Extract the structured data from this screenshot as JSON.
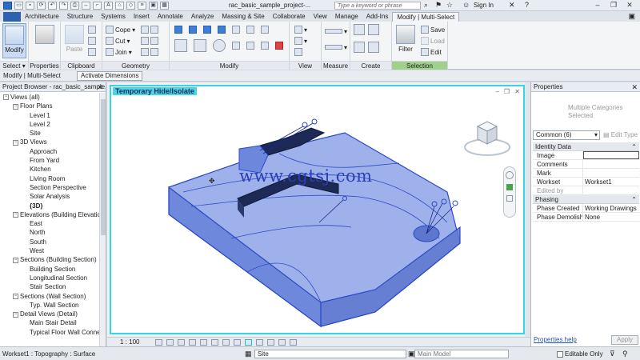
{
  "titlebar": {
    "doc_title": "rac_basic_sample_project-...",
    "search_placeholder": "Type a keyword or phrase",
    "signin": "Sign In",
    "help": "?",
    "minimize": "–",
    "restore": "❐",
    "close": "✕"
  },
  "tabs": [
    "Architecture",
    "Structure",
    "Systems",
    "Insert",
    "Annotate",
    "Analyze",
    "Massing & Site",
    "Collaborate",
    "View",
    "Manage",
    "Add-Ins",
    "Modify | Multi-Select"
  ],
  "ribbon": {
    "select": {
      "modify": "Modify",
      "label": "Select ▾"
    },
    "properties": {
      "label": "Properties"
    },
    "clipboard": {
      "paste": "Paste",
      "label": "Clipboard"
    },
    "geometry": {
      "cope": "Cope",
      "cut": "Cut",
      "join": "Join",
      "label": "Geometry"
    },
    "modify": {
      "label": "Modify"
    },
    "view": {
      "label": "View"
    },
    "measure": {
      "label": "Measure"
    },
    "create": {
      "label": "Create"
    },
    "selection": {
      "filter": "Filter",
      "save": "Save",
      "load": "Load",
      "edit": "Edit",
      "label": "Selection"
    },
    "panel_colors": {
      "selection_label_bg": "#9fd18a"
    }
  },
  "options_bar": {
    "context": "Modify | Multi-Select",
    "activate_dimensions": "Activate Dimensions"
  },
  "project_browser": {
    "title": "Project Browser - rac_basic_sample...",
    "close": "✕",
    "tree": [
      {
        "label": "Views (all)",
        "level": 0,
        "toggle": "−"
      },
      {
        "label": "Floor Plans",
        "level": 1,
        "toggle": "−"
      },
      {
        "label": "Level 1",
        "level": 2
      },
      {
        "label": "Level 2",
        "level": 2
      },
      {
        "label": "Site",
        "level": 2
      },
      {
        "label": "3D Views",
        "level": 1,
        "toggle": "−"
      },
      {
        "label": "Approach",
        "level": 2
      },
      {
        "label": "From Yard",
        "level": 2
      },
      {
        "label": "Kitchen",
        "level": 2
      },
      {
        "label": "Living Room",
        "level": 2
      },
      {
        "label": "Section Perspective",
        "level": 2
      },
      {
        "label": "Solar Analysis",
        "level": 2
      },
      {
        "label": "{3D}",
        "level": 2,
        "bold": true
      },
      {
        "label": "Elevations (Building Elevation)",
        "level": 1,
        "toggle": "−"
      },
      {
        "label": "East",
        "level": 2
      },
      {
        "label": "North",
        "level": 2
      },
      {
        "label": "South",
        "level": 2
      },
      {
        "label": "West",
        "level": 2
      },
      {
        "label": "Sections (Building Section)",
        "level": 1,
        "toggle": "−"
      },
      {
        "label": "Building Section",
        "level": 2
      },
      {
        "label": "Longitudinal Section",
        "level": 2
      },
      {
        "label": "Stair Section",
        "level": 2
      },
      {
        "label": "Sections (Wall Section)",
        "level": 1,
        "toggle": "−"
      },
      {
        "label": "Typ. Wall Section",
        "level": 2
      },
      {
        "label": "Detail Views (Detail)",
        "level": 1,
        "toggle": "−"
      },
      {
        "label": "Main Stair Detail",
        "level": 2
      },
      {
        "label": "Typical Floor Wall Connection",
        "level": 2
      }
    ]
  },
  "viewport": {
    "banner": "Temporary Hide/Isolate",
    "watermark": "www.cgtsj.com",
    "minimize": "–",
    "restore": "❐",
    "close": "✕",
    "scale": "1 : 100",
    "highlight_color": "#35d5e6",
    "selection_color": "#4a6fd8"
  },
  "properties": {
    "title": "Properties",
    "close": "✕",
    "multiple_categories": "Multiple Categories",
    "selected": "Selected",
    "type_selector": "Common (6)",
    "edit_type": "Edit Type",
    "groups": [
      {
        "name": "Identity Data",
        "rows": [
          {
            "k": "Image",
            "v": "",
            "box": true
          },
          {
            "k": "Comments",
            "v": ""
          },
          {
            "k": "Mark",
            "v": ""
          },
          {
            "k": "Workset",
            "v": "Workset1"
          },
          {
            "k": "Edited by",
            "v": "",
            "dim": true
          }
        ]
      },
      {
        "name": "Phasing",
        "rows": [
          {
            "k": "Phase Created",
            "v": "Working Drawings"
          },
          {
            "k": "Phase Demolish...",
            "v": "None"
          }
        ]
      }
    ],
    "help": "Properties help",
    "apply": "Apply"
  },
  "status_bar": {
    "text": "Workset1 : Topography : Surface",
    "view": "Site",
    "model": "Main Model",
    "editable_only": "Editable Only"
  }
}
